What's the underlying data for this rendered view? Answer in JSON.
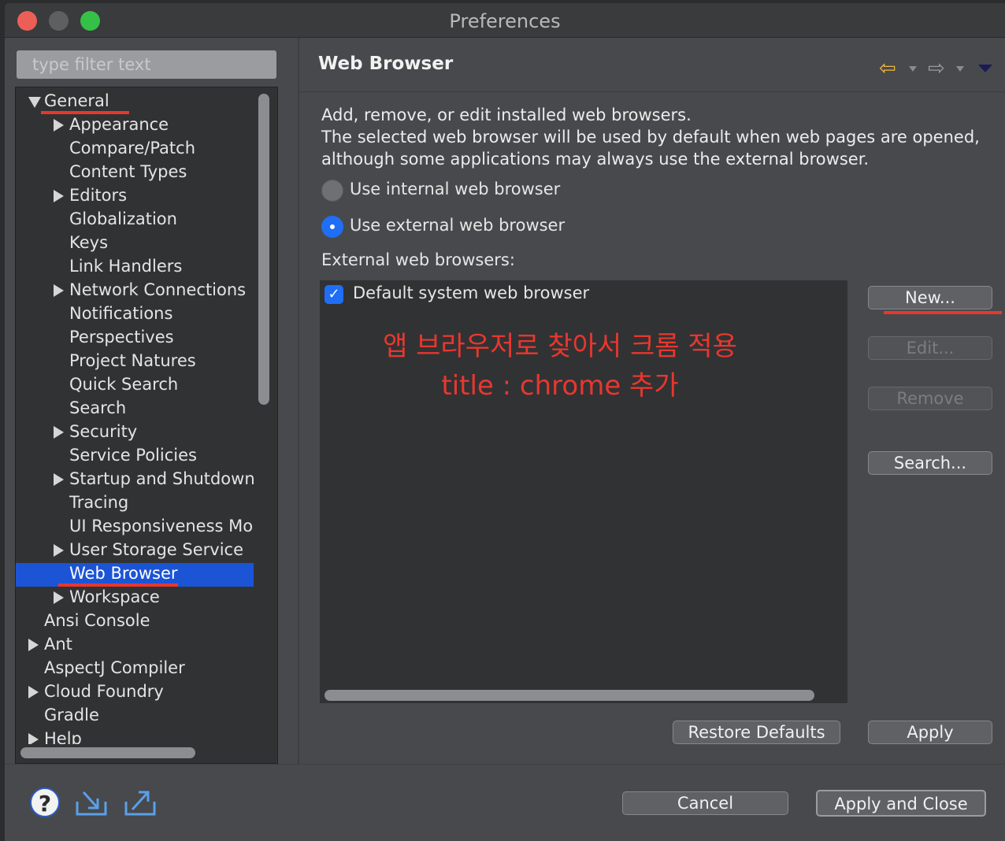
{
  "window": {
    "title": "Preferences"
  },
  "filter": {
    "placeholder": "type filter text"
  },
  "tree": {
    "items": [
      {
        "label": "General",
        "twisty": "expanded",
        "level": 0,
        "selected": false,
        "marked": true
      },
      {
        "label": "Appearance",
        "twisty": "collapsed",
        "level": 1,
        "selected": false
      },
      {
        "label": "Compare/Patch",
        "twisty": "none",
        "level": 1,
        "selected": false
      },
      {
        "label": "Content Types",
        "twisty": "none",
        "level": 1,
        "selected": false
      },
      {
        "label": "Editors",
        "twisty": "collapsed",
        "level": 1,
        "selected": false
      },
      {
        "label": "Globalization",
        "twisty": "none",
        "level": 1,
        "selected": false
      },
      {
        "label": "Keys",
        "twisty": "none",
        "level": 1,
        "selected": false
      },
      {
        "label": "Link Handlers",
        "twisty": "none",
        "level": 1,
        "selected": false
      },
      {
        "label": "Network Connections",
        "twisty": "collapsed",
        "level": 1,
        "selected": false
      },
      {
        "label": "Notifications",
        "twisty": "none",
        "level": 1,
        "selected": false
      },
      {
        "label": "Perspectives",
        "twisty": "none",
        "level": 1,
        "selected": false
      },
      {
        "label": "Project Natures",
        "twisty": "none",
        "level": 1,
        "selected": false
      },
      {
        "label": "Quick Search",
        "twisty": "none",
        "level": 1,
        "selected": false
      },
      {
        "label": "Search",
        "twisty": "none",
        "level": 1,
        "selected": false
      },
      {
        "label": "Security",
        "twisty": "collapsed",
        "level": 1,
        "selected": false
      },
      {
        "label": "Service Policies",
        "twisty": "none",
        "level": 1,
        "selected": false
      },
      {
        "label": "Startup and Shutdown",
        "twisty": "collapsed",
        "level": 1,
        "selected": false
      },
      {
        "label": "Tracing",
        "twisty": "none",
        "level": 1,
        "selected": false
      },
      {
        "label": "UI Responsiveness Mo",
        "twisty": "none",
        "level": 1,
        "selected": false
      },
      {
        "label": "User Storage Service",
        "twisty": "collapsed",
        "level": 1,
        "selected": false
      },
      {
        "label": "Web Browser",
        "twisty": "none",
        "level": 1,
        "selected": true,
        "marked": true
      },
      {
        "label": "Workspace",
        "twisty": "collapsed",
        "level": 1,
        "selected": false
      },
      {
        "label": "Ansi Console",
        "twisty": "none",
        "level": 0,
        "selected": false
      },
      {
        "label": "Ant",
        "twisty": "collapsed",
        "level": 0,
        "selected": false
      },
      {
        "label": "AspectJ Compiler",
        "twisty": "none",
        "level": 0,
        "selected": false
      },
      {
        "label": "Cloud Foundry",
        "twisty": "collapsed",
        "level": 0,
        "selected": false
      },
      {
        "label": "Gradle",
        "twisty": "none",
        "level": 0,
        "selected": false
      },
      {
        "label": "Help",
        "twisty": "collapsed",
        "level": 0,
        "selected": false
      }
    ]
  },
  "page": {
    "title": "Web Browser",
    "nav": {
      "back_icon": "arrow-left-icon",
      "forward_icon": "arrow-right-icon",
      "menu_icon": "view-menu-icon"
    },
    "description": [
      "Add, remove, or edit installed web browsers.",
      "The selected web browser will be used by default when web pages are opened,",
      "although some applications may always use the external browser."
    ],
    "radio_internal": "Use internal web browser",
    "radio_external": "Use external web browser",
    "selected_mode": "external",
    "external_label": "External web browsers:",
    "browsers": [
      {
        "label": "Default system web browser",
        "checked": true
      }
    ],
    "annotation": {
      "line1": "앱 브라우저로 찾아서 크롬 적용",
      "line2": "title : chrome 추가",
      "color": "#e8372e"
    },
    "buttons": {
      "new": "New...",
      "edit": "Edit...",
      "remove": "Remove",
      "search": "Search..."
    },
    "restore_defaults": "Restore Defaults",
    "apply": "Apply"
  },
  "footer": {
    "cancel": "Cancel",
    "apply_close": "Apply and Close",
    "icons": [
      "help-icon",
      "import-icon",
      "export-icon"
    ]
  },
  "colors": {
    "selection": "#1c54d6",
    "accent": "#1f6ef5",
    "annotation": "#e8372e",
    "background": "#47494c"
  }
}
